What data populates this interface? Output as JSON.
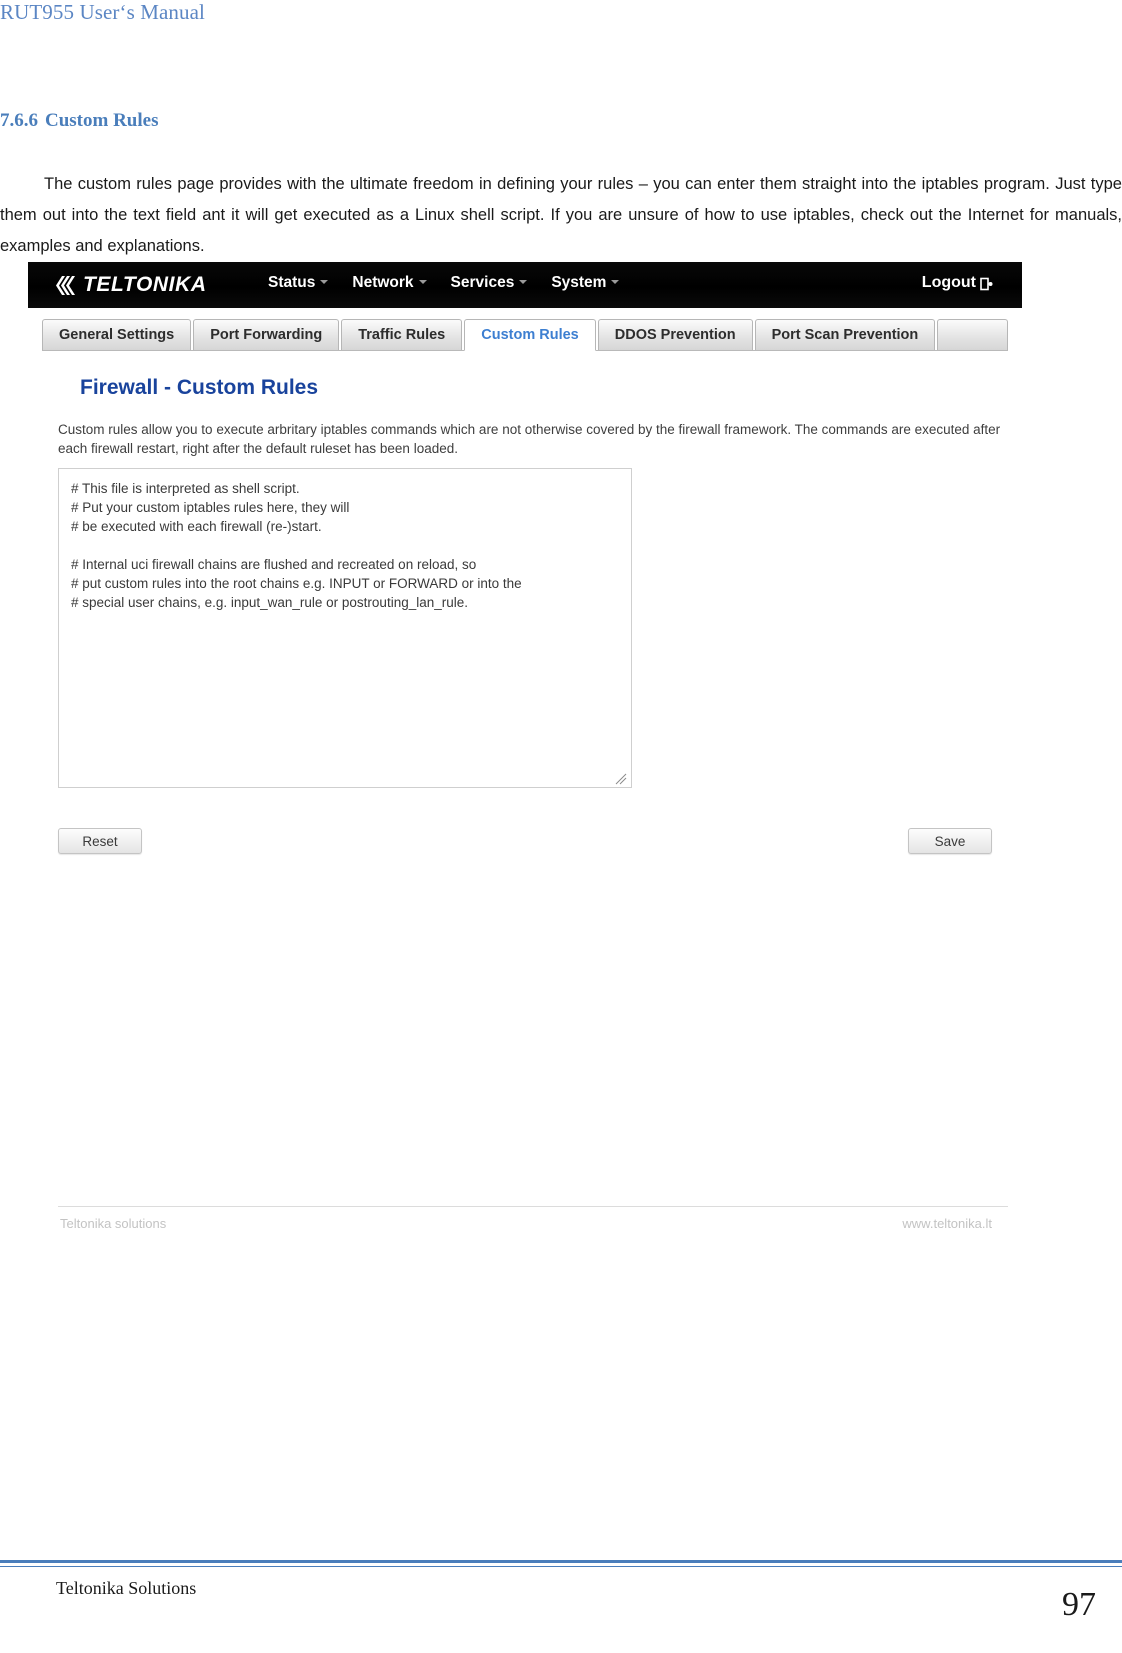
{
  "document": {
    "header_title": "RUT955 User‘s Manual",
    "section_number": "7.6.6",
    "section_title": "Custom Rules",
    "paragraph": "The custom rules page provides with the ultimate freedom in defining your rules – you can enter them straight into the iptables program. Just type them out into the text field ant it will get executed as a Linux shell script. If you are unsure of how to use iptables, check out the Internet for manuals, examples and explanations.",
    "footer_label": "Teltonika Solutions",
    "page_number": "97",
    "accent_color": "#4a7ebb"
  },
  "screenshot": {
    "navbar": {
      "brand": "TELTONIKA",
      "brand_icon": "teltonika-chevrons-icon",
      "menu": [
        {
          "label": "Status",
          "caret": true
        },
        {
          "label": "Network",
          "caret": true
        },
        {
          "label": "Services",
          "caret": true
        },
        {
          "label": "System",
          "caret": true
        }
      ],
      "logout_label": "Logout",
      "logout_icon": "exit-icon"
    },
    "tabs": [
      {
        "label": "General Settings",
        "active": false
      },
      {
        "label": "Port Forwarding",
        "active": false
      },
      {
        "label": "Traffic Rules",
        "active": false
      },
      {
        "label": "Custom Rules",
        "active": true
      },
      {
        "label": "DDOS Prevention",
        "active": false
      },
      {
        "label": "Port Scan Prevention",
        "active": false
      }
    ],
    "panel": {
      "title": "Firewall - Custom Rules",
      "description": "Custom rules allow you to execute arbritary iptables commands which are not otherwise covered by the firewall framework. The commands are executed after each firewall restart, right after the default ruleset has been loaded.",
      "textarea_value": "# This file is interpreted as shell script.\n# Put your custom iptables rules here, they will\n# be executed with each firewall (re-)start.\n\n# Internal uci firewall chains are flushed and recreated on reload, so\n# put custom rules into the root chains e.g. INPUT or FORWARD or into the\n# special user chains, e.g. input_wan_rule or postrouting_lan_rule.",
      "reset_label": "Reset",
      "save_label": "Save",
      "active_tab_color": "#3d7fd1",
      "title_color": "#19439c"
    },
    "footer": {
      "left": "Teltonika solutions",
      "right": "www.teltonika.lt"
    }
  }
}
